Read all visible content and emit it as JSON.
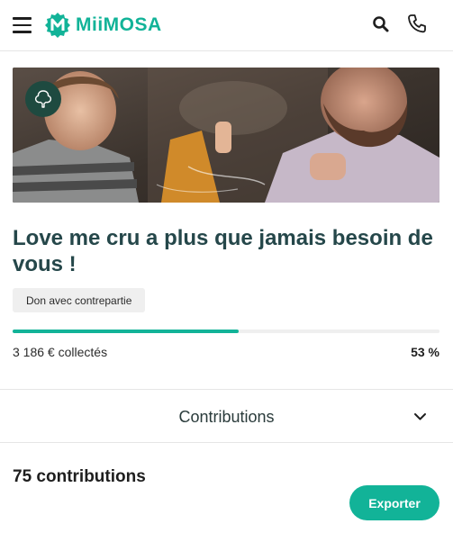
{
  "header": {
    "brand": "MiiMOSA",
    "menu_icon": "hamburger-menu-icon",
    "search_icon": "search-icon",
    "phone_icon": "phone-icon",
    "brand_color": "#12b398"
  },
  "project": {
    "image_alt": "Love me cru project photo",
    "badge_icon": "tree-icon",
    "title": "Love me cru a plus que jamais besoin de vous  !",
    "type_tag": "Don avec contrepartie",
    "progress_percent": 53,
    "collected_text": "3 186 € collectés",
    "percent_text": "53 %"
  },
  "contributions": {
    "section_label": "Contributions",
    "toggle_icon": "chevron-down-icon",
    "count_text": "75 contributions",
    "export_label": "Exporter"
  }
}
